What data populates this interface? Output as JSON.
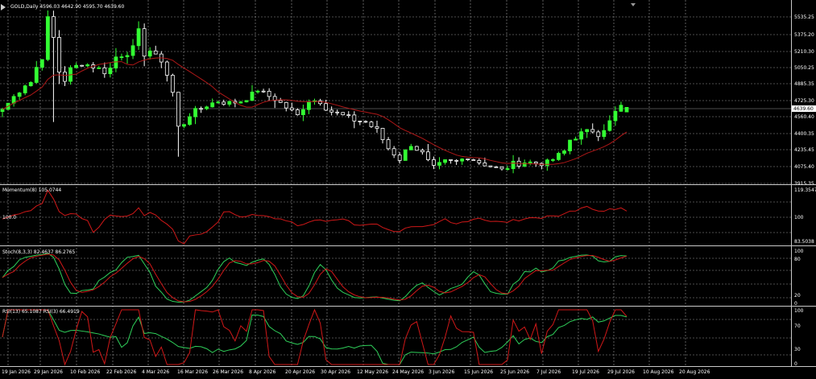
{
  "window": {
    "title": "GOLD,Daily"
  },
  "colors": {
    "background": "#000000",
    "grid": "#9a9a9a",
    "separator": "#c8c8c8",
    "text": "#ffffff",
    "bull": "#33ff33",
    "bear": "#ffffff",
    "ma": "#b01818",
    "signal": "#2fd05a",
    "main": "#d01818",
    "price_line": "#9a9a9a"
  },
  "panels": [
    {
      "id": "price",
      "label": "GOLD,Daily  4596.03 4642.90 4595.70 4639.60",
      "ticks": [
        "5535.25",
        "5375.20",
        "5210.30",
        "5050.25",
        "4885.35",
        "4725.30",
        "4560.40",
        "4400.35",
        "4235.45",
        "4075.40",
        "3915.35"
      ],
      "current": "4639.60"
    },
    {
      "id": "momentum",
      "label": "Momentum(8) 105.0744",
      "ticks": [
        "119.3547",
        "100",
        "83.5038"
      ],
      "inner_label": "100.0"
    },
    {
      "id": "stoch",
      "label": "Stoch(8,3,3) 82.4637 86.2765",
      "ticks": [
        "100",
        "80",
        "20",
        "0"
      ]
    },
    {
      "id": "rsi",
      "label": "RSI(13) 65.1087  RSI(3) 66.4919",
      "ticks": [
        "100",
        "70",
        "30",
        "0"
      ]
    }
  ],
  "xaxis": [
    "19 Jan 2026",
    "29 Jan 2026",
    "10 Feb 2026",
    "22 Feb 2026",
    "4 Mar 2026",
    "16 Mar 2026",
    "26 Mar 2026",
    "8 Apr 2026",
    "20 Apr 2026",
    "30 Apr 2026",
    "12 May 2026",
    "24 May 2026",
    "3 Jun 2026",
    "15 Jun 2026",
    "25 Jun 2026",
    "7 Jul 2026",
    "19 Jul 2026",
    "29 Jul 2026",
    "10 Aug 2026",
    "20 Aug 2026"
  ],
  "chart_data": {
    "type": "candlestick",
    "instrument": "GOLD",
    "timeframe": "Daily",
    "last_bar": {
      "open": 4596.03,
      "high": 4642.9,
      "low": 4595.7,
      "close": 4639.6
    },
    "price_range": [
      3915.35,
      5600
    ],
    "close_anchors": [
      [
        0,
        4620
      ],
      [
        2,
        4740
      ],
      [
        4,
        4860
      ],
      [
        5,
        4880
      ],
      [
        6,
        5020
      ],
      [
        7,
        5120
      ],
      [
        8,
        5480
      ],
      [
        9,
        5300
      ],
      [
        10,
        4980
      ],
      [
        11,
        4900
      ],
      [
        12,
        5000
      ],
      [
        14,
        5060
      ],
      [
        16,
        5030
      ],
      [
        18,
        4980
      ],
      [
        19,
        5010
      ],
      [
        20,
        5120
      ],
      [
        22,
        5160
      ],
      [
        23,
        5200
      ],
      [
        24,
        5360
      ],
      [
        25,
        5150
      ],
      [
        26,
        5180
      ],
      [
        27,
        5120
      ],
      [
        28,
        5090
      ],
      [
        29,
        4950
      ],
      [
        30,
        4780
      ],
      [
        31,
        4450
      ],
      [
        32,
        4490
      ],
      [
        33,
        4570
      ],
      [
        34,
        4600
      ],
      [
        36,
        4660
      ],
      [
        38,
        4700
      ],
      [
        40,
        4680
      ],
      [
        42,
        4700
      ],
      [
        44,
        4760
      ],
      [
        45,
        4810
      ],
      [
        46,
        4770
      ],
      [
        48,
        4720
      ],
      [
        50,
        4640
      ],
      [
        51,
        4600
      ],
      [
        52,
        4560
      ],
      [
        53,
        4640
      ],
      [
        54,
        4710
      ],
      [
        56,
        4700
      ],
      [
        57,
        4640
      ],
      [
        58,
        4600
      ],
      [
        60,
        4560
      ],
      [
        62,
        4520
      ],
      [
        64,
        4500
      ],
      [
        66,
        4420
      ],
      [
        68,
        4250
      ],
      [
        70,
        4150
      ],
      [
        71,
        4220
      ],
      [
        72,
        4290
      ],
      [
        74,
        4200
      ],
      [
        75,
        4120
      ],
      [
        76,
        4060
      ],
      [
        78,
        4120
      ],
      [
        80,
        4120
      ],
      [
        82,
        4170
      ],
      [
        84,
        4120
      ],
      [
        86,
        4080
      ],
      [
        88,
        4040
      ],
      [
        90,
        4100
      ],
      [
        92,
        4120
      ],
      [
        94,
        4110
      ],
      [
        96,
        4110
      ],
      [
        98,
        4180
      ],
      [
        99,
        4220
      ],
      [
        100,
        4330
      ],
      [
        102,
        4390
      ],
      [
        104,
        4420
      ],
      [
        105,
        4390
      ],
      [
        106,
        4440
      ],
      [
        107,
        4500
      ],
      [
        108,
        4590
      ],
      [
        109,
        4650
      ],
      [
        110,
        4640
      ]
    ],
    "indicators": {
      "moving_average": "red line on price panel",
      "momentum": {
        "period": 8,
        "value": 105.0744,
        "range": [
          83.5038,
          119.3547
        ],
        "level": 100
      },
      "stochastic": {
        "params": [
          8,
          3,
          3
        ],
        "main": 82.4637,
        "signal": 86.2765,
        "levels": [
          0,
          20,
          80,
          100
        ]
      },
      "rsi": [
        {
          "period": 13,
          "value": 65.1087
        },
        {
          "period": 3,
          "value": 66.4919
        }
      ],
      "rsi_levels": [
        0,
        30,
        70,
        100
      ]
    }
  }
}
